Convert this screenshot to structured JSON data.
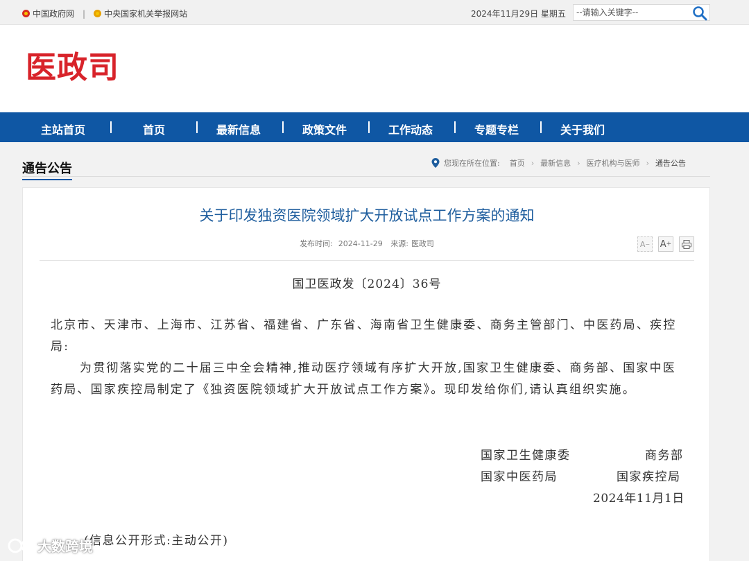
{
  "topbar": {
    "link1": "中国政府网",
    "separator": "|",
    "link2": "中央国家机关举报网站",
    "date": "2024年11月29日 星期五",
    "search_placeholder": "--请输入关键字--"
  },
  "header": {
    "logo_text": "医政司"
  },
  "nav": {
    "items": [
      {
        "label": "主站首页"
      },
      {
        "label": "首页"
      },
      {
        "label": "最新信息"
      },
      {
        "label": "政策文件"
      },
      {
        "label": "工作动态"
      },
      {
        "label": "专题专栏"
      },
      {
        "label": "关于我们"
      }
    ]
  },
  "section": {
    "title": "通告公告",
    "breadcrumb": {
      "prefix": "您现在所在位置:",
      "items": [
        "首页",
        "最新信息",
        "医疗机构与医师",
        "通告公告"
      ]
    }
  },
  "article": {
    "title": "关于印发独资医院领域扩大开放试点工作方案的通知",
    "meta_publish_label": "发布时间:",
    "meta_publish_date": "2024-11-29",
    "meta_source_label": "来源:",
    "meta_source": "医政司",
    "tools": {
      "font_smaller": "A",
      "font_larger": "A",
      "print": "print"
    },
    "doc_number": "国卫医政发〔2024〕36号",
    "addressee": "北京市、天津市、上海市、江苏省、福建省、广东省、海南省卫生健康委、商务主管部门、中医药局、疾控局:",
    "paragraph": "为贯彻落实党的二十届三中全会精神,推动医疗领域有序扩大开放,国家卫生健康委、商务部、国家中医药局、国家疾控局制定了《独资医院领域扩大开放试点工作方案》。现印发给你们,请认真组织实施。",
    "signatories": {
      "sig1": "国家卫生健康委",
      "sig2": "商务部",
      "sig3": "国家中医药局",
      "sig4": "国家疾控局",
      "date": "2024年11月1日"
    },
    "disclosure": "(信息公开形式:主动公开)"
  },
  "watermark": {
    "text": "大数跨境"
  },
  "colors": {
    "nav_bg": "#0f57a4",
    "logo_red": "#d8232a",
    "title_blue": "#1f5e9e"
  }
}
